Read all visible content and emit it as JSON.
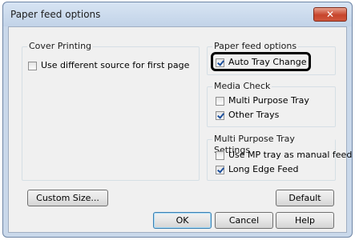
{
  "window": {
    "title": "Paper feed options",
    "close_glyph": "✕"
  },
  "cover_printing": {
    "legend": "Cover Printing",
    "use_different_source": {
      "label": "Use different source for first page",
      "checked": false
    }
  },
  "paper_feed_options": {
    "legend": "Paper feed options",
    "auto_tray_change": {
      "label": "Auto Tray Change",
      "checked": true
    }
  },
  "media_check": {
    "legend": "Media Check",
    "multi_purpose_tray": {
      "label": "Multi Purpose Tray",
      "checked": false
    },
    "other_trays": {
      "label": "Other Trays",
      "checked": true
    }
  },
  "mp_tray_settings": {
    "legend": "Multi Purpose Tray Settings",
    "use_mp_manual": {
      "label": "Use MP tray as manual feed",
      "checked": false
    },
    "long_edge_feed": {
      "label": "Long Edge Feed",
      "checked": true
    }
  },
  "buttons": {
    "custom_size": "Custom Size...",
    "default": "Default",
    "ok": "OK",
    "cancel": "Cancel",
    "help": "Help"
  },
  "colors": {
    "titlebar": "#c9d8ea",
    "close_button": "#c7452c",
    "check_mark": "#1c4f9c",
    "highlight_outline": "#000000"
  }
}
